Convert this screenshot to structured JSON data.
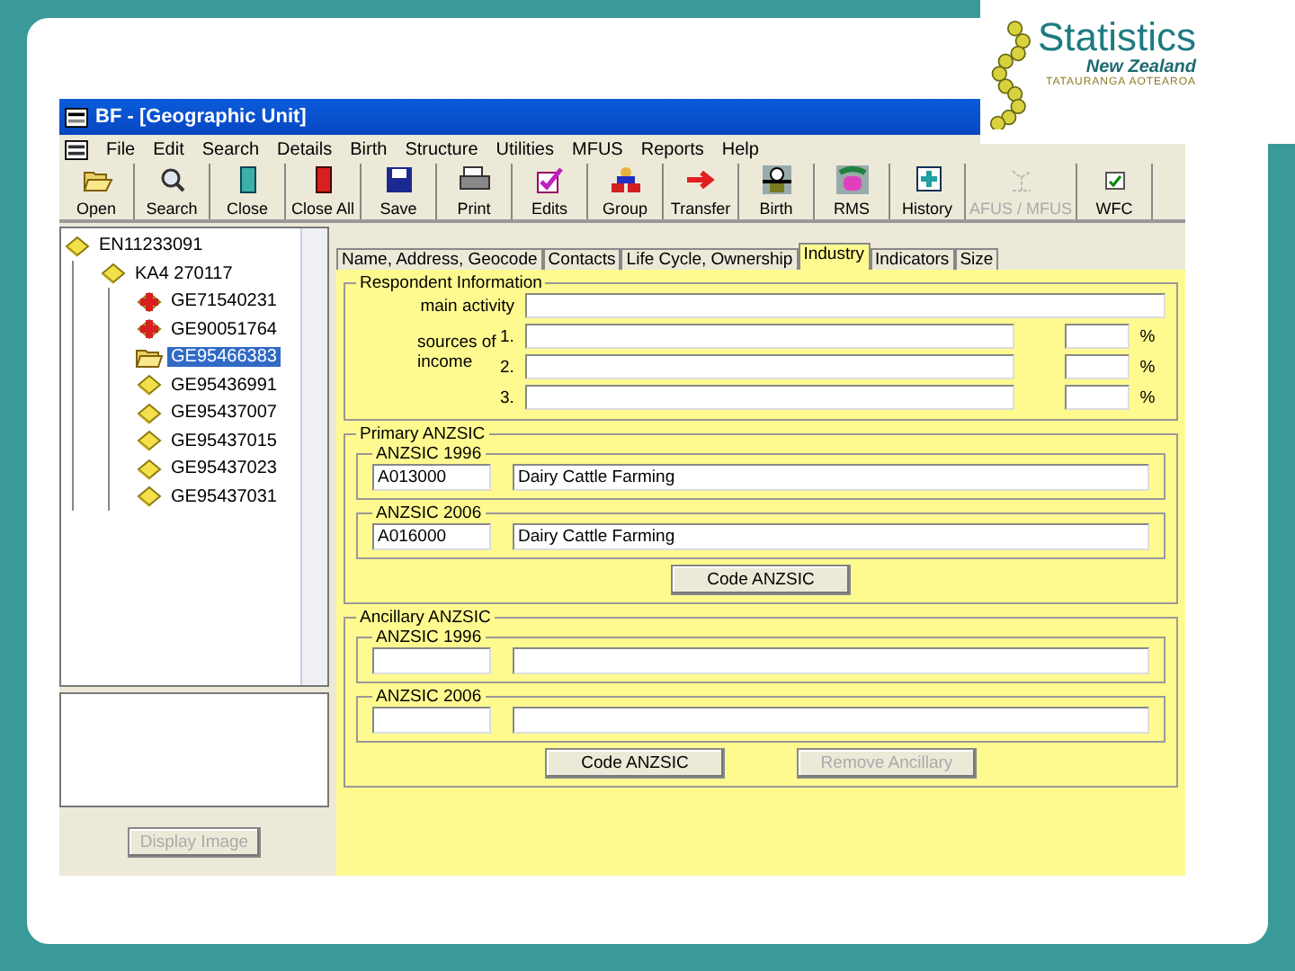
{
  "slide": {
    "logo": {
      "name": "Statistics",
      "country": "New Zealand",
      "motto": "TATAURANGA AOTEAROA"
    }
  },
  "window": {
    "title": "BF - [Geographic Unit]"
  },
  "menu": [
    "File",
    "Edit",
    "Search",
    "Details",
    "Birth",
    "Structure",
    "Utilities",
    "MFUS",
    "Reports",
    "Help"
  ],
  "toolbar": [
    {
      "label": "Open",
      "disabled": false
    },
    {
      "label": "Search",
      "disabled": false
    },
    {
      "label": "Close",
      "disabled": false
    },
    {
      "label": "Close All",
      "disabled": false
    },
    {
      "label": "Save",
      "disabled": false
    },
    {
      "label": "Print",
      "disabled": false
    },
    {
      "label": "Edits",
      "disabled": false
    },
    {
      "label": "Group",
      "disabled": false
    },
    {
      "label": "Transfer",
      "disabled": false
    },
    {
      "label": "Birth",
      "disabled": false
    },
    {
      "label": "RMS",
      "disabled": false
    },
    {
      "label": "History",
      "disabled": false
    },
    {
      "label": "AFUS / MFUS",
      "disabled": true
    },
    {
      "label": "WFC",
      "disabled": false
    }
  ],
  "tree": [
    {
      "label": "EN11233091",
      "kind": "unit",
      "selected": false,
      "children": [
        {
          "label": "KA4 270117",
          "kind": "unit",
          "selected": false,
          "children": [
            {
              "label": "GE71540231",
              "kind": "alert",
              "selected": false
            },
            {
              "label": "GE90051764",
              "kind": "alert",
              "selected": false
            },
            {
              "label": "GE95466383",
              "kind": "folder",
              "selected": true
            },
            {
              "label": "GE95436991",
              "kind": "unit",
              "selected": false
            },
            {
              "label": "GE95437007",
              "kind": "unit",
              "selected": false
            },
            {
              "label": "GE95437015",
              "kind": "unit",
              "selected": false
            },
            {
              "label": "GE95437023",
              "kind": "unit",
              "selected": false
            },
            {
              "label": "GE95437031",
              "kind": "unit",
              "selected": false
            }
          ]
        }
      ]
    }
  ],
  "display_image_button": {
    "label": "Display Image",
    "disabled": true
  },
  "tabs": [
    {
      "label": "Name, Address, Geocode",
      "selected": false
    },
    {
      "label": "Contacts",
      "selected": false
    },
    {
      "label": "Life Cycle, Ownership",
      "selected": false
    },
    {
      "label": "Industry",
      "selected": true
    },
    {
      "label": "Indicators",
      "selected": false
    },
    {
      "label": "Size",
      "selected": false
    }
  ],
  "respondent": {
    "title": "Respondent Information",
    "main_activity_label": "main activity",
    "sources_label": "sources of income",
    "income_rows": [
      {
        "number": "1.",
        "percent": "%"
      },
      {
        "number": "2.",
        "percent": "%"
      },
      {
        "number": "3.",
        "percent": "%"
      }
    ]
  },
  "primary": {
    "title": "Primary ANZSIC",
    "groups": [
      {
        "title": "ANZSIC 1996",
        "code": "A013000",
        "description": "Dairy Cattle Farming"
      },
      {
        "title": "ANZSIC 2006",
        "code": "A016000",
        "description": "Dairy Cattle Farming"
      }
    ],
    "buttons": [
      {
        "label": "Code ANZSIC",
        "disabled": false
      }
    ]
  },
  "ancillary": {
    "title": "Ancillary ANZSIC",
    "groups": [
      {
        "title": "ANZSIC 1996"
      },
      {
        "title": "ANZSIC 2006"
      }
    ],
    "buttons": [
      {
        "label": "Code ANZSIC",
        "disabled": false
      },
      {
        "label": "Remove Ancillary",
        "disabled": true
      }
    ]
  }
}
